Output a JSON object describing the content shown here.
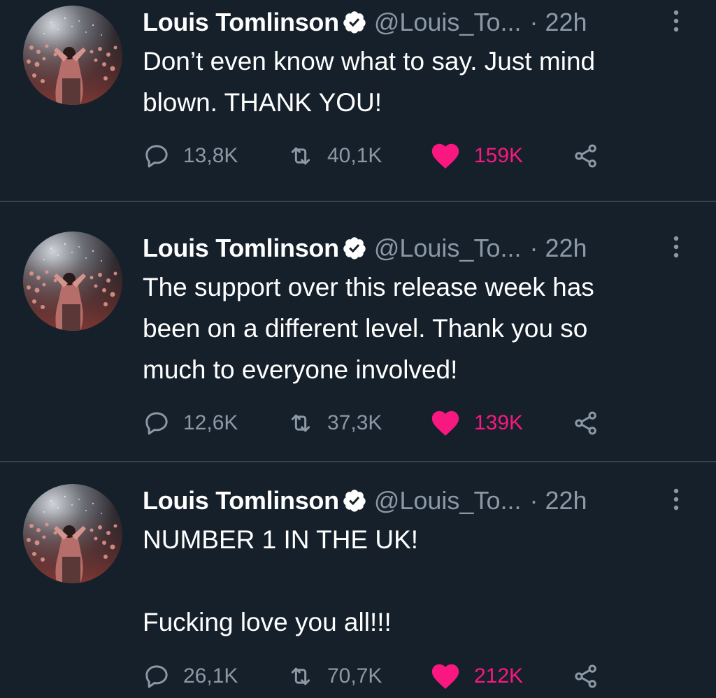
{
  "tweets": [
    {
      "author_name": "Louis Tomlinson",
      "handle": "@Louis_To...",
      "separator": "·",
      "time": "22h",
      "text": "Don’t even know what to say. Just mind\nblown. THANK YOU!",
      "replies": "13,8K",
      "retweets": "40,1K",
      "likes": "159K",
      "liked": true
    },
    {
      "author_name": "Louis Tomlinson",
      "handle": "@Louis_To...",
      "separator": "·",
      "time": "22h",
      "text": "The support over this release week has\nbeen on a different level. Thank you so\nmuch to everyone involved!",
      "replies": "12,6K",
      "retweets": "37,3K",
      "likes": "139K",
      "liked": true
    },
    {
      "author_name": "Louis Tomlinson",
      "handle": "@Louis_To...",
      "separator": "·",
      "time": "22h",
      "text": "NUMBER 1 IN THE UK!\n\nFucking love you all!!!",
      "replies": "26,1K",
      "retweets": "70,7K",
      "likes": "212K",
      "liked": true
    }
  ],
  "icons": {
    "verified": "verified-badge-icon",
    "more": "more-options-icon",
    "reply": "reply-icon",
    "retweet": "retweet-icon",
    "like": "heart-icon",
    "share": "share-icon"
  },
  "colors": {
    "background": "#15202b",
    "text": "#ffffff",
    "secondary": "#8b98a5",
    "like_active": "#f91880",
    "divider": "#38444d"
  }
}
